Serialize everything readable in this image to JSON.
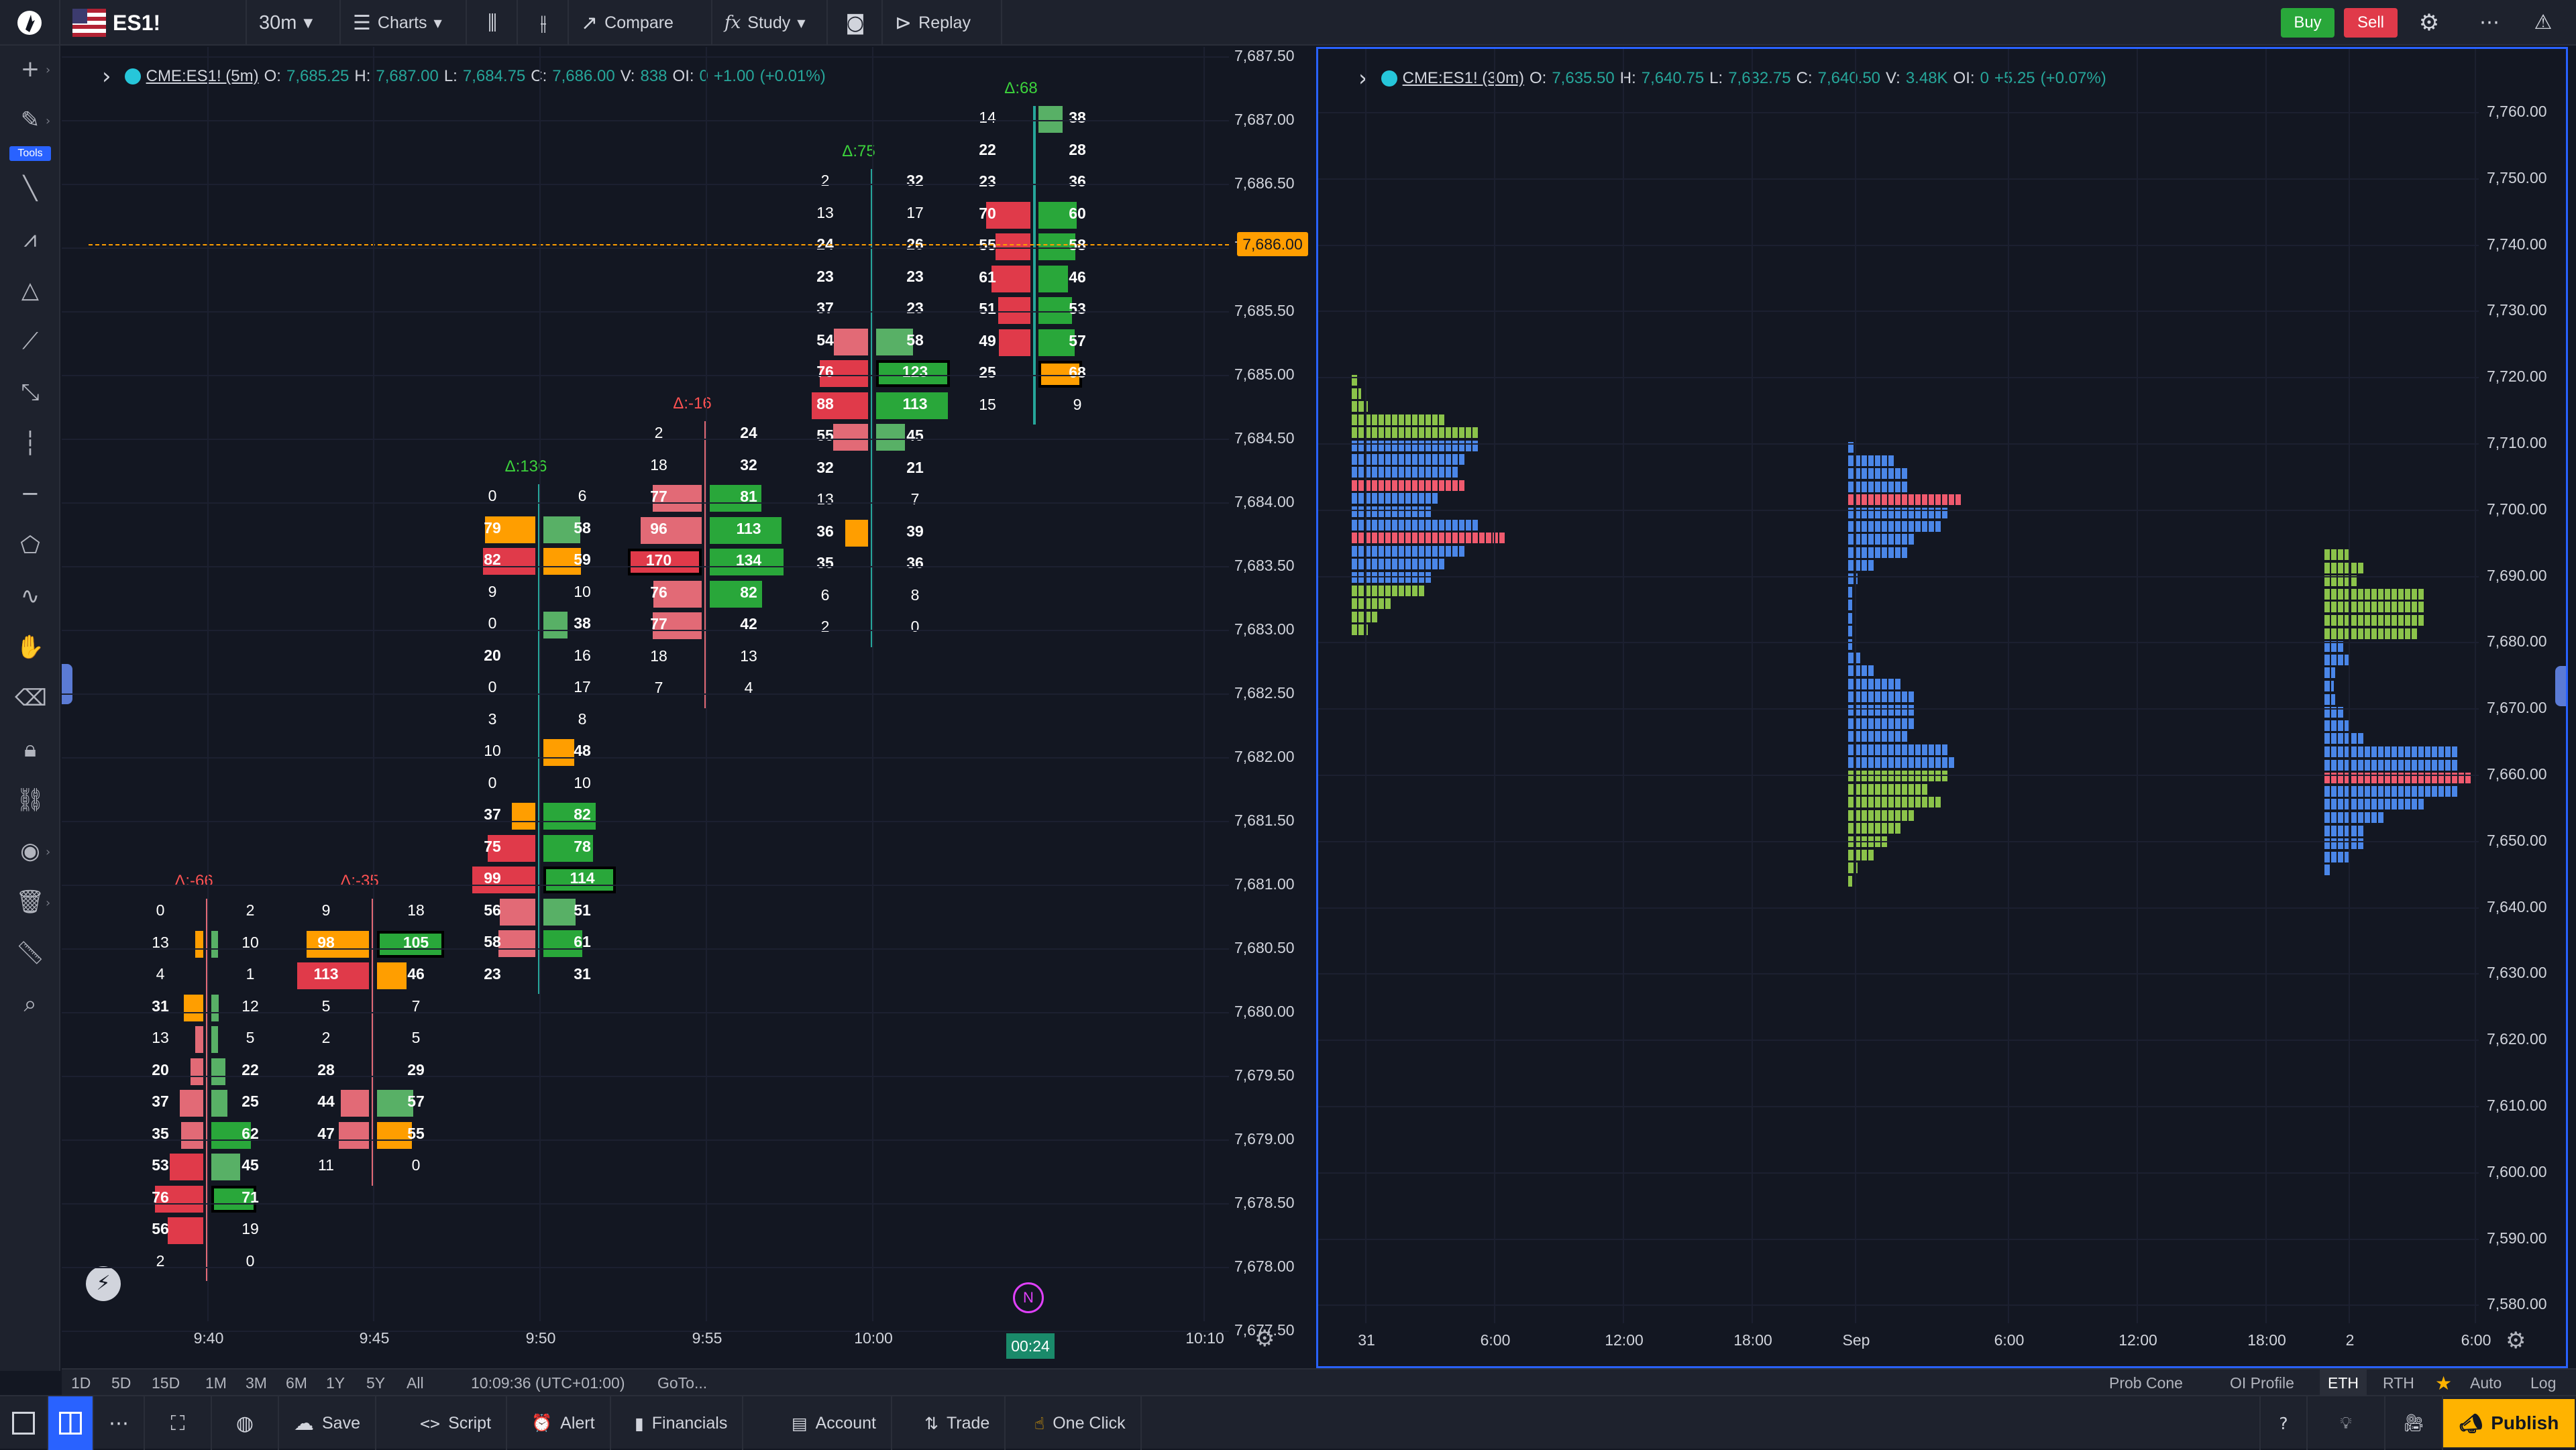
{
  "topbar": {
    "symbol": "ES1!",
    "interval": "30m",
    "charts": "Charts",
    "compare": "Compare",
    "study": "Study",
    "replay": "Replay",
    "buy": "Buy",
    "sell": "Sell"
  },
  "leftbar": {
    "tools_badge": "Tools"
  },
  "chart1": {
    "legend": {
      "symbol": "CME:ES1! (5m)",
      "o_label": "O:",
      "o": "7,685.25",
      "h_label": "H:",
      "h": "7,687.00",
      "l_label": "L:",
      "l": "7,684.75",
      "c_label": "C:",
      "c": "7,686.00",
      "v_label": "V:",
      "v": "838",
      "oi_label": "OI:",
      "oi": "0",
      "chg": "+1.00",
      "chg_pct": "(+0.01%)"
    },
    "price_ticks": [
      "7,687.50",
      "7,687.00",
      "7,686.50",
      "7,686.00",
      "7,685.50",
      "7,685.00",
      "7,684.50",
      "7,684.00",
      "7,683.50",
      "7,683.00",
      "7,682.50",
      "7,682.00",
      "7,681.50",
      "7,681.00",
      "7,680.50",
      "7,680.00",
      "7,679.50",
      "7,679.00",
      "7,678.50",
      "7,678.00",
      "7,677.50"
    ],
    "current_price": "7,686.00",
    "time_ticks": [
      "9:40",
      "9:45",
      "9:50",
      "9:55",
      "10:00",
      "10:10"
    ],
    "countdown": "00:24",
    "n_marker": "N",
    "footprint": [
      {
        "delta": "Δ:-66",
        "rows": [
          [
            0,
            2,
            "",
            ""
          ],
          [
            13,
            10,
            "orange",
            "lgreen"
          ],
          [
            4,
            1,
            "",
            ""
          ],
          [
            31,
            12,
            "orange",
            "lgreen"
          ],
          [
            13,
            5,
            "lred",
            "lgreen"
          ],
          [
            20,
            22,
            "lred",
            "lgreen"
          ],
          [
            37,
            25,
            "lred",
            "lgreen"
          ],
          [
            35,
            62,
            "lred",
            "green"
          ],
          [
            53,
            45,
            "red",
            "lgreen"
          ],
          [
            76,
            71,
            "red",
            "greenbox"
          ],
          [
            56,
            19,
            "red",
            ""
          ],
          [
            2,
            0,
            "",
            ""
          ]
        ]
      },
      {
        "delta": "Δ:-35",
        "rows": [
          [
            9,
            18,
            "",
            ""
          ],
          [
            98,
            105,
            "orange",
            "greenbox"
          ],
          [
            113,
            46,
            "red",
            "orange"
          ],
          [
            5,
            7,
            "",
            ""
          ],
          [
            2,
            5,
            "",
            ""
          ],
          [
            28,
            29,
            "",
            ""
          ],
          [
            44,
            57,
            "lred",
            "lgreen"
          ],
          [
            47,
            55,
            "lred",
            "orange"
          ],
          [
            11,
            0,
            "",
            ""
          ]
        ]
      },
      {
        "delta": "Δ:136",
        "rows": [
          [
            0,
            6,
            "",
            ""
          ],
          [
            79,
            58,
            "orange",
            "lgreen"
          ],
          [
            82,
            59,
            "red",
            "orange"
          ],
          [
            9,
            10,
            "",
            ""
          ],
          [
            0,
            38,
            "",
            "lgreen"
          ],
          [
            20,
            16,
            "",
            ""
          ],
          [
            0,
            17,
            "",
            ""
          ],
          [
            3,
            8,
            "",
            ""
          ],
          [
            10,
            48,
            "",
            "orange"
          ],
          [
            0,
            10,
            "",
            ""
          ],
          [
            37,
            82,
            "orange",
            "green"
          ],
          [
            75,
            78,
            "red",
            "green"
          ],
          [
            99,
            114,
            "red",
            "greenbox"
          ],
          [
            56,
            51,
            "lred",
            "lgreen"
          ],
          [
            58,
            61,
            "lred",
            "green"
          ],
          [
            23,
            31,
            "",
            ""
          ]
        ]
      },
      {
        "delta": "Δ:-16",
        "rows": [
          [
            2,
            24,
            "",
            ""
          ],
          [
            18,
            32,
            "",
            ""
          ],
          [
            77,
            81,
            "lred",
            "green"
          ],
          [
            96,
            113,
            "lred",
            "green"
          ],
          [
            170,
            134,
            "redbox",
            "green"
          ],
          [
            76,
            82,
            "lred",
            "green"
          ],
          [
            77,
            42,
            "lred",
            ""
          ],
          [
            18,
            13,
            "",
            ""
          ],
          [
            7,
            4,
            "",
            ""
          ]
        ]
      },
      {
        "delta": "Δ:75",
        "rows": [
          [
            2,
            32,
            "",
            ""
          ],
          [
            13,
            17,
            "",
            ""
          ],
          [
            24,
            26,
            "",
            ""
          ],
          [
            23,
            23,
            "",
            ""
          ],
          [
            37,
            23,
            "",
            ""
          ],
          [
            54,
            58,
            "lred",
            "lgreen"
          ],
          [
            76,
            123,
            "red",
            "greenbox"
          ],
          [
            88,
            113,
            "red",
            "green"
          ],
          [
            55,
            45,
            "lred",
            "lgreen"
          ],
          [
            32,
            21,
            "",
            ""
          ],
          [
            13,
            7,
            "",
            ""
          ],
          [
            36,
            39,
            "orange",
            ""
          ],
          [
            35,
            36,
            "",
            ""
          ],
          [
            6,
            8,
            "",
            ""
          ],
          [
            2,
            0,
            "",
            ""
          ]
        ]
      },
      {
        "delta": "Δ:68",
        "rows": [
          [
            14,
            38,
            "",
            "lgreen"
          ],
          [
            22,
            28,
            "",
            ""
          ],
          [
            23,
            36,
            "",
            ""
          ],
          [
            70,
            60,
            "red",
            "green"
          ],
          [
            55,
            58,
            "red",
            "green"
          ],
          [
            61,
            46,
            "red",
            "green"
          ],
          [
            51,
            53,
            "red",
            "green"
          ],
          [
            49,
            57,
            "red",
            "green"
          ],
          [
            25,
            68,
            "",
            "orangebox"
          ],
          [
            15,
            9,
            "",
            ""
          ]
        ]
      }
    ]
  },
  "chart2": {
    "legend": {
      "symbol": "CME:ES1! (30m)",
      "o_label": "O:",
      "o": "7,635.50",
      "h_label": "H:",
      "h": "7,640.75",
      "l_label": "L:",
      "l": "7,632.75",
      "c_label": "C:",
      "c": "7,640.50",
      "v_label": "V:",
      "v": "3.48K",
      "oi_label": "OI:",
      "oi": "0",
      "chg": "+5.25",
      "chg_pct": "(+0.07%)"
    },
    "price_ticks": [
      "7,760.00",
      "7,750.00",
      "7,740.00",
      "7,730.00",
      "7,720.00",
      "7,710.00",
      "7,700.00",
      "7,690.00",
      "7,680.00",
      "7,670.00",
      "7,660.00",
      "7,650.00",
      "7,640.00",
      "7,630.00",
      "7,620.00",
      "7,610.00",
      "7,600.00",
      "7,590.00",
      "7,580.00"
    ],
    "time_ticks": [
      "31",
      "6:00",
      "12:00",
      "18:00",
      "Sep",
      "6:00",
      "12:00",
      "18:00",
      "2",
      "6:00"
    ]
  },
  "bottom": {
    "ranges": [
      "1D",
      "5D",
      "15D",
      "1M",
      "3M",
      "6M",
      "1Y",
      "5Y",
      "All"
    ],
    "clock": "10:09:36 (UTC+01:00)",
    "goto": "GoTo...",
    "prob_cone": "Prob Cone",
    "oi_profile": "OI Profile",
    "eth": "ETH",
    "rth": "RTH",
    "auto": "Auto",
    "log": "Log"
  },
  "footer": {
    "save": "Save",
    "script": "Script",
    "alert": "Alert",
    "financials": "Financials",
    "account": "Account",
    "trade": "Trade",
    "one_click": "One Click",
    "publish": "Publish"
  },
  "colors": {
    "bg": "#131722",
    "panel": "#1e222d",
    "up": "#26a69a",
    "buy": "#29a73a",
    "sell": "#e03a4a",
    "orange": "#ff9e00",
    "vp_blue": "#4a86e8",
    "vp_green": "#8bc34a",
    "vp_red": "#f05a6e",
    "publish": "#ffb300",
    "accent": "#2962ff"
  }
}
